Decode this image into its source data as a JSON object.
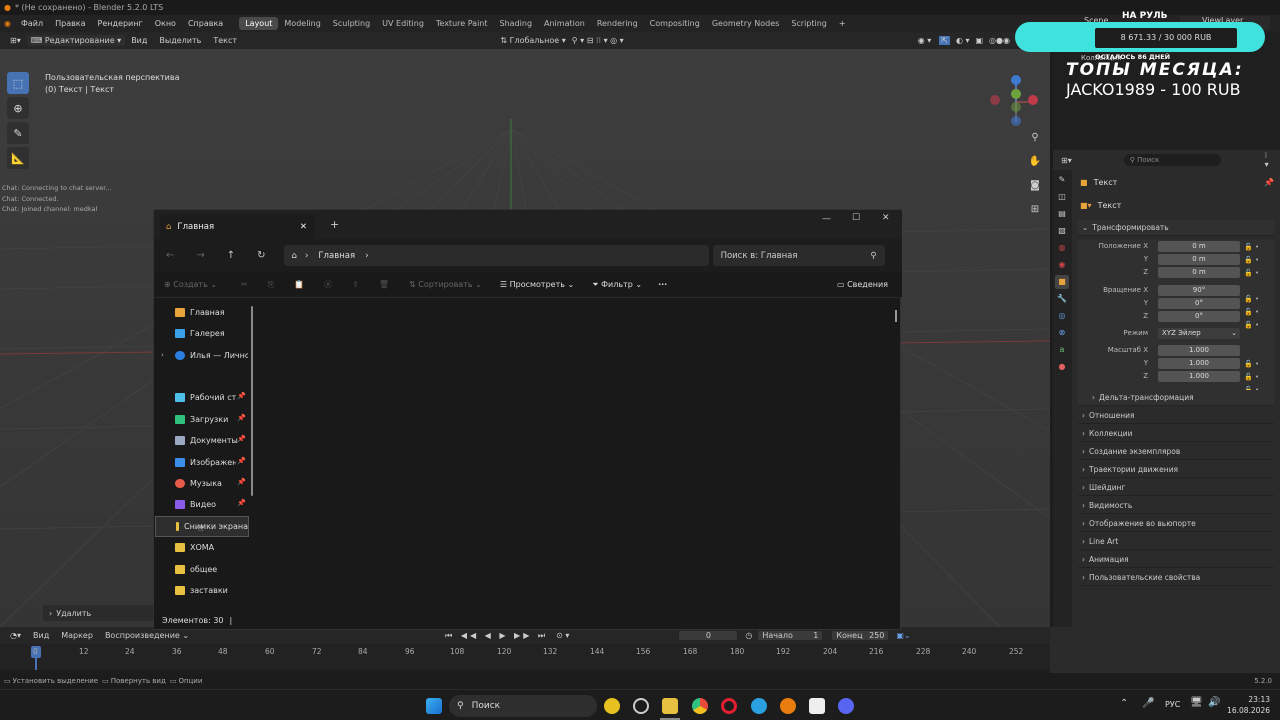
{
  "title": "* (Не сохранено) - Blender 5.2.0 LTS",
  "menu": [
    "Файл",
    "Правка",
    "Рендеринг",
    "Окно",
    "Справка"
  ],
  "workspaces": [
    "Layout",
    "Modeling",
    "Sculpting",
    "UV Editing",
    "Texture Paint",
    "Shading",
    "Animation",
    "Rendering",
    "Compositing",
    "Geometry Nodes",
    "Scripting"
  ],
  "header": {
    "mode": "Редактирование",
    "view": "Вид",
    "select": "Выделить",
    "text": "Текст",
    "orientation": "Глобальное"
  },
  "viewport": {
    "perspective": "Пользовательская перспектива",
    "object_info": "(0) Текст | Текст"
  },
  "chat": [
    "Chat: Connecting to chat server...",
    "Chat: Connected.",
    "Chat: Joined channel: medkal"
  ],
  "last_operator": "Удалить",
  "overlay": {
    "head": "НА РУЛЬ",
    "amount": "8 671.33 / 30 000 RUB",
    "left": "ОСТАЛОСЬ 86 ДНЕЙ",
    "tops_title": "ТОПЫ МЕСЯЦА:",
    "tops_entry": "JACKO1989 - 100 RUB",
    "scene_label": "Scene",
    "view_layer": "ViewLayer",
    "collection": "Коллекция"
  },
  "props": {
    "search": "Поиск",
    "object_name": "Текст",
    "data_name": "Текст",
    "transform": "Трансформировать",
    "loc_label": "Положение X",
    "rot_label": "Вращение X",
    "mode_label": "Режим",
    "scale_label": "Масштаб X",
    "y": "Y",
    "z": "Z",
    "loc": [
      "0 m",
      "0 m",
      "0 m"
    ],
    "rot": [
      "90°",
      "0°",
      "0°"
    ],
    "mode": "XYZ Эйлер",
    "scale": [
      "1.000",
      "1.000",
      "1.000"
    ],
    "delta": "Дельта-трансформация",
    "sections": [
      "Отношения",
      "Коллекции",
      "Создание экземпляров",
      "Траектории движения",
      "Шейдинг",
      "Видимость",
      "Отображение во вьюпорте",
      "Line Art",
      "Анимация",
      "Пользовательские свойства"
    ]
  },
  "timeline": {
    "view": "Вид",
    "marker": "Маркер",
    "playback": "Воспроизведение",
    "frame": "0",
    "start_label": "Начало",
    "start": "1",
    "end_label": "Конец",
    "end": "250",
    "ticks": [
      "0",
      "12",
      "24",
      "36",
      "48",
      "60",
      "72",
      "84",
      "96",
      "108",
      "120",
      "132",
      "144",
      "156",
      "168",
      "180",
      "192",
      "204",
      "216",
      "228",
      "240",
      "252"
    ]
  },
  "status": {
    "a": "Установить выделение",
    "b": "Повернуть вид",
    "c": "Опции",
    "version": "5.2.0"
  },
  "explorer": {
    "tab": "Главная",
    "breadcrumb": "Главная",
    "search_placeholder": "Поиск в: Главная",
    "create": "Создать",
    "sort": "Сортировать",
    "view": "Просмотреть",
    "filter": "Фильтр",
    "details": "Сведения",
    "nav": [
      {
        "label": "Главная",
        "color": "#e8a33a"
      },
      {
        "label": "Галерея",
        "color": "#3aa0e8"
      },
      {
        "label": "Илья — Личное",
        "color": "#2a7ee0"
      },
      {
        "label": "Рабочий стол",
        "color": "#4ec0e8",
        "pin": true
      },
      {
        "label": "Загрузки",
        "color": "#2ec27e",
        "pin": true
      },
      {
        "label": "Документы",
        "color": "#9aa8c0",
        "pin": true
      },
      {
        "label": "Изображения",
        "color": "#3a8ee8",
        "pin": true
      },
      {
        "label": "Музыка",
        "color": "#e85a4a",
        "pin": true
      },
      {
        "label": "Видео",
        "color": "#8a5ae8",
        "pin": true
      },
      {
        "label": "Снимки экрана",
        "color": "#e8c040"
      },
      {
        "label": "ХОМА",
        "color": "#e8c040"
      },
      {
        "label": "общее",
        "color": "#e8c040"
      },
      {
        "label": "заставки",
        "color": "#e8c040"
      }
    ],
    "status": "Элементов: 30"
  },
  "taskbar": {
    "search": "Поиск",
    "lang": "РУС",
    "time": "23:13",
    "date": "16.08.2026"
  }
}
